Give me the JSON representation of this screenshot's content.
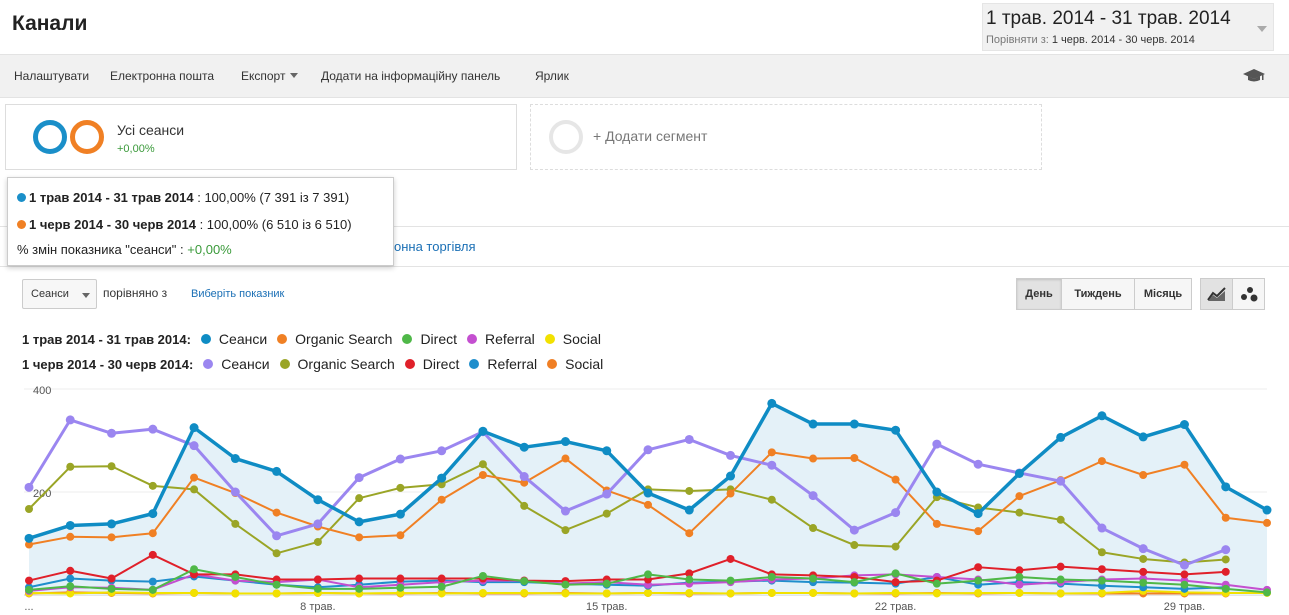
{
  "header": {
    "title": "Канали",
    "date_range": "1 трав. 2014 - 31 трав. 2014",
    "compare_label": "Порівняти з:",
    "compare_range": "1 черв. 2014 - 30 черв. 2014"
  },
  "toolbar": {
    "settings": "Налаштувати",
    "email": "Електронна пошта",
    "export": "Експорт",
    "add_dashboard": "Додати на інформаційну панель",
    "shortcut": "Ярлик",
    "icon": "graduation-cap-icon"
  },
  "segments": {
    "all_sessions": "Усі сеанси",
    "all_sessions_change": "+0,00%",
    "add_segment": "+ Додати сегмент",
    "colors": {
      "primary": "#1a8fc9",
      "secondary": "#f08024",
      "positive": "#3a9a3a"
    }
  },
  "tooltip": {
    "row1_range": "1 трав 2014 - 31 трав 2014",
    "row1_value": ": 100,00% (7 391 із 7 391)",
    "row2_range": "1 черв 2014 - 30 черв 2014",
    "row2_value": ": 100,00% (6 510 із 6 510)",
    "row3_label": "% змін показника \"сеанси\" :",
    "row3_value": "+0,00%"
  },
  "tabs": {
    "partial_ecommerce": "онна торгівля"
  },
  "controls": {
    "metric_select": "Сеанси",
    "compared_with": "порівняно з",
    "choose_metric": "Виберіть показник",
    "day": "День",
    "week": "Тиждень",
    "month": "Місяць"
  },
  "chart_data": {
    "type": "line",
    "y_ticks": [
      "400",
      "200"
    ],
    "ylim": [
      0,
      400
    ],
    "x_ticks": [
      {
        "label": "...",
        "index": 0
      },
      {
        "label": "8 трав.",
        "index": 7
      },
      {
        "label": "15 трав.",
        "index": 14
      },
      {
        "label": "22 трав.",
        "index": 21
      },
      {
        "label": "29 трав.",
        "index": 28
      }
    ],
    "legend": [
      {
        "group": "1 трав 2014 - 31 трав 2014:",
        "items": [
          {
            "name": "Сеанси",
            "color": "#0f8cc4"
          },
          {
            "name": "Organic Search",
            "color": "#f08024"
          },
          {
            "name": "Direct",
            "color": "#4fb848"
          },
          {
            "name": "Referral",
            "color": "#c44fd0"
          },
          {
            "name": "Social",
            "color": "#f2e100"
          }
        ]
      },
      {
        "group": "1 черв 2014 - 30 черв 2014:",
        "items": [
          {
            "name": "Сеанси",
            "color": "#9b86f0"
          },
          {
            "name": "Organic Search",
            "color": "#9aa526"
          },
          {
            "name": "Direct",
            "color": "#e0202a"
          },
          {
            "name": "Referral",
            "color": "#1f8ecc"
          },
          {
            "name": "Social",
            "color": "#f07f24"
          }
        ]
      }
    ],
    "series": [
      {
        "name": "Сеанси",
        "period": "1 трав 2014 - 31 трав 2014",
        "color": "#0f8cc4",
        "width": 3.5,
        "area": true,
        "values": [
          110,
          135,
          138,
          158,
          325,
          265,
          240,
          185,
          142,
          157,
          227,
          318,
          287,
          298,
          280,
          198,
          165,
          231,
          372,
          332,
          332,
          320,
          200,
          158,
          236,
          306,
          348,
          307,
          331,
          210,
          165
        ]
      },
      {
        "name": "Сеанси",
        "period": "1 черв 2014 - 30 черв 2014",
        "color": "#9b86f0",
        "width": 3,
        "values": [
          209,
          340,
          314,
          322,
          290,
          200,
          115,
          138,
          228,
          264,
          280,
          317,
          230,
          163,
          196,
          282,
          302,
          271,
          252,
          193,
          126,
          160,
          293,
          254,
          237,
          221,
          130,
          90,
          58,
          88
        ]
      },
      {
        "name": "Organic Search",
        "period": "1 трав 2014 - 31 трав 2014",
        "color": "#f08024",
        "width": 2,
        "values": [
          98,
          113,
          112,
          120,
          228,
          198,
          160,
          133,
          112,
          116,
          185,
          233,
          218,
          265,
          203,
          175,
          120,
          197,
          277,
          265,
          266,
          224,
          138,
          124,
          192,
          223,
          260,
          233,
          253,
          150,
          140
        ]
      },
      {
        "name": "Organic Search",
        "period": "1 черв 2014 - 30 черв 2014",
        "color": "#9aa526",
        "width": 2,
        "values": [
          167,
          249,
          250,
          212,
          205,
          138,
          81,
          103,
          188,
          208,
          215,
          254,
          173,
          126,
          158,
          205,
          202,
          205,
          185,
          130,
          97,
          94,
          190,
          170,
          160,
          146,
          83,
          70,
          63,
          69
        ]
      },
      {
        "name": "Direct",
        "period": "1 трав 2014 - 31 трав 2014",
        "color": "#4fb848",
        "width": 2,
        "values": [
          10,
          17,
          12,
          10,
          50,
          35,
          20,
          12,
          12,
          14,
          16,
          37,
          27,
          20,
          22,
          40,
          30,
          28,
          35,
          32,
          25,
          42,
          22,
          28,
          35,
          30,
          28,
          24,
          20,
          12,
          5
        ]
      },
      {
        "name": "Direct",
        "period": "1 черв 2014 - 30 черв 2014",
        "color": "#e0202a",
        "width": 2,
        "values": [
          28,
          47,
          32,
          78,
          40,
          40,
          30,
          30,
          32,
          32,
          32,
          32,
          28,
          27,
          30,
          30,
          42,
          70,
          40,
          38,
          35,
          25,
          28,
          54,
          48,
          55,
          50,
          45,
          40,
          45
        ]
      },
      {
        "name": "Referral",
        "period": "1 трав 2014 - 31 трав 2014",
        "color": "#c44fd0",
        "width": 2,
        "values": [
          8,
          15,
          14,
          10,
          40,
          28,
          25,
          30,
          15,
          20,
          25,
          28,
          28,
          22,
          25,
          20,
          22,
          25,
          30,
          32,
          38,
          40,
          35,
          30,
          20,
          25,
          30,
          32,
          28,
          20,
          10
        ]
      },
      {
        "name": "Referral",
        "period": "1 черв 2014 - 30 черв 2014",
        "color": "#1f8ecc",
        "width": 2,
        "values": [
          15,
          32,
          28,
          26,
          36,
          28,
          20,
          15,
          20,
          26,
          28,
          25,
          25,
          22,
          20,
          18,
          24,
          26,
          28,
          25,
          24,
          22,
          35,
          20,
          25,
          22,
          18,
          15,
          12,
          15
        ]
      },
      {
        "name": "Social",
        "period": "1 трав 2014 - 31 трав 2014",
        "color": "#f2e100",
        "width": 2,
        "values": [
          4,
          3,
          5,
          4,
          4,
          3,
          3,
          4,
          3,
          4,
          3,
          4,
          4,
          3,
          3,
          4,
          4,
          3,
          4,
          4,
          3,
          4,
          3,
          4,
          4,
          3,
          4,
          8,
          5,
          4,
          4
        ]
      },
      {
        "name": "Social",
        "period": "1 черв 2014 - 30 черв 2014",
        "color": "#f07f24",
        "width": 2,
        "values": [
          3,
          5,
          4,
          3,
          4,
          3,
          3,
          4,
          3,
          3,
          4,
          3,
          3,
          4,
          3,
          4,
          3,
          3,
          4,
          4,
          3,
          3,
          4,
          3,
          4,
          3,
          3,
          3,
          3,
          3
        ]
      }
    ]
  }
}
